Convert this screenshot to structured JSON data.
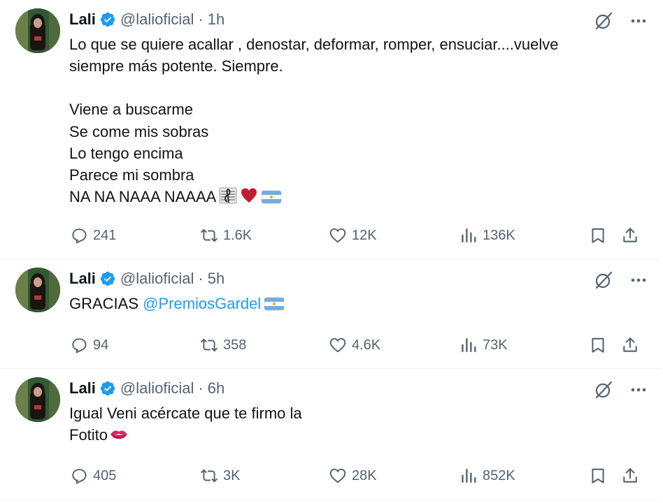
{
  "tweets": [
    {
      "name": "Lali",
      "handle": "@lalioficial",
      "separator": "·",
      "time": "1h",
      "lines": [
        "Lo que se quiere acallar , denostar, deformar, romper, ensuciar....vuelve",
        "siempre más potente. Siempre.",
        "",
        "Viene a buscarme",
        "Se come mis sobras",
        "Lo tengo encima",
        "Parece mi sombra",
        "NA NA NAAA NAAAA"
      ],
      "emojis": [
        "musical-score-emoji",
        "red-heart-emoji",
        "argentina-flag-emoji"
      ],
      "replies": "241",
      "reposts": "1.6K",
      "likes": "12K",
      "views": "136K"
    },
    {
      "name": "Lali",
      "handle": "@lalioficial",
      "separator": "·",
      "time": "5h",
      "text_prefix": "GRACIAS ",
      "mention": "@PremiosGardel",
      "emojis": [
        "argentina-flag-emoji"
      ],
      "replies": "94",
      "reposts": "358",
      "likes": "4.6K",
      "views": "73K"
    },
    {
      "name": "Lali",
      "handle": "@lalioficial",
      "separator": "·",
      "time": "6h",
      "lines": [
        "Igual Veni acércate que te firmo la",
        "Fotito"
      ],
      "emojis": [
        "kiss-mark-emoji"
      ],
      "replies": "405",
      "reposts": "3K",
      "likes": "28K",
      "views": "852K"
    }
  ],
  "icons": {
    "verified": "verified-badge-icon",
    "grok": "grok-icon",
    "more": "more-options-icon",
    "reply": "reply-icon",
    "repost": "repost-icon",
    "like": "like-icon",
    "views": "views-icon",
    "bookmark": "bookmark-icon",
    "share": "share-icon"
  },
  "colors": {
    "accent": "#1d9bf0",
    "text": "#0f1419",
    "secondary": "#536471",
    "divider": "#eff3f4",
    "heart": "#be1e2d",
    "kiss": "#e0245e"
  }
}
